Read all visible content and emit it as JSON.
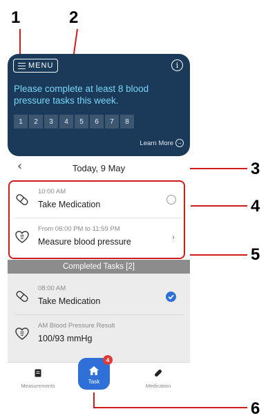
{
  "callouts": [
    "1",
    "2",
    "3",
    "4",
    "5",
    "6"
  ],
  "header": {
    "menu_label": "MENU",
    "message": "Please complete at least 8 blood pressure tasks this week.",
    "task_tiles": [
      "1",
      "2",
      "3",
      "4",
      "5",
      "6",
      "7",
      "8"
    ],
    "learn_more": "Learn More"
  },
  "date_bar": {
    "date": "Today, 9 May"
  },
  "pending_tasks": [
    {
      "time": "10:00 AM",
      "title": "Take Medication",
      "icon": "pill-icon",
      "action": "status-circle"
    },
    {
      "time": "From 06:00 PM to 11:59 PM",
      "title": "Measure blood pressure",
      "icon": "heart-icon",
      "action": "chevron-right"
    }
  ],
  "completed": {
    "header": "Completed Tasks [2]",
    "items": [
      {
        "time": "08:00 AM",
        "title": "Take Medication",
        "icon": "pill-icon"
      },
      {
        "time": "AM Blood Pressure Result",
        "title": "100/93 mmHg",
        "icon": "heart-icon"
      }
    ]
  },
  "tabbar": {
    "measurements": "Measurements",
    "task": "Task",
    "task_badge": "4",
    "medication": "Medication"
  },
  "colors": {
    "header_bg": "#1b3a5a",
    "message": "#79d6f7",
    "accent": "#2e6fd8",
    "callout": "#d11a1a",
    "completed_header": "#8c8c8c"
  }
}
